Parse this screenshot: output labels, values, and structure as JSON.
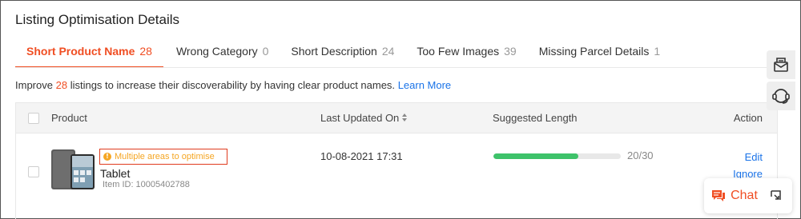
{
  "page": {
    "title": "Listing Optimisation Details"
  },
  "tabs": [
    {
      "label": "Short Product Name",
      "count": "28",
      "active": true
    },
    {
      "label": "Wrong Category",
      "count": "0",
      "active": false
    },
    {
      "label": "Short Description",
      "count": "24",
      "active": false
    },
    {
      "label": "Too Few Images",
      "count": "39",
      "active": false
    },
    {
      "label": "Missing Parcel Details",
      "count": "1",
      "active": false
    }
  ],
  "intro": {
    "prefix": "Improve",
    "count": "28",
    "suffix": "listings to increase their discoverability by having clear product names.",
    "link": "Learn More"
  },
  "table": {
    "headers": {
      "product": "Product",
      "last_updated": "Last Updated On",
      "suggested_length": "Suggested Length",
      "action": "Action"
    },
    "rows": [
      {
        "badge": "Multiple areas to optimise",
        "badge_icon": "warning-icon",
        "name": "Tablet",
        "item_id": "Item ID: 10005402788",
        "updated": "10-08-2021 17:31",
        "length_text": "20/30",
        "length_progress": 0.667,
        "actions": [
          "Edit",
          "Ignore"
        ]
      }
    ]
  },
  "chat": {
    "label": "Chat"
  },
  "colors": {
    "accent": "#f04e23",
    "link": "#1a73e8",
    "progress": "#3ec26a",
    "warning": "#f5a623"
  },
  "icons": {
    "message": "envelope-icon",
    "support": "headset-icon",
    "chat": "chat-bubble-icon",
    "expand": "expand-icon"
  }
}
